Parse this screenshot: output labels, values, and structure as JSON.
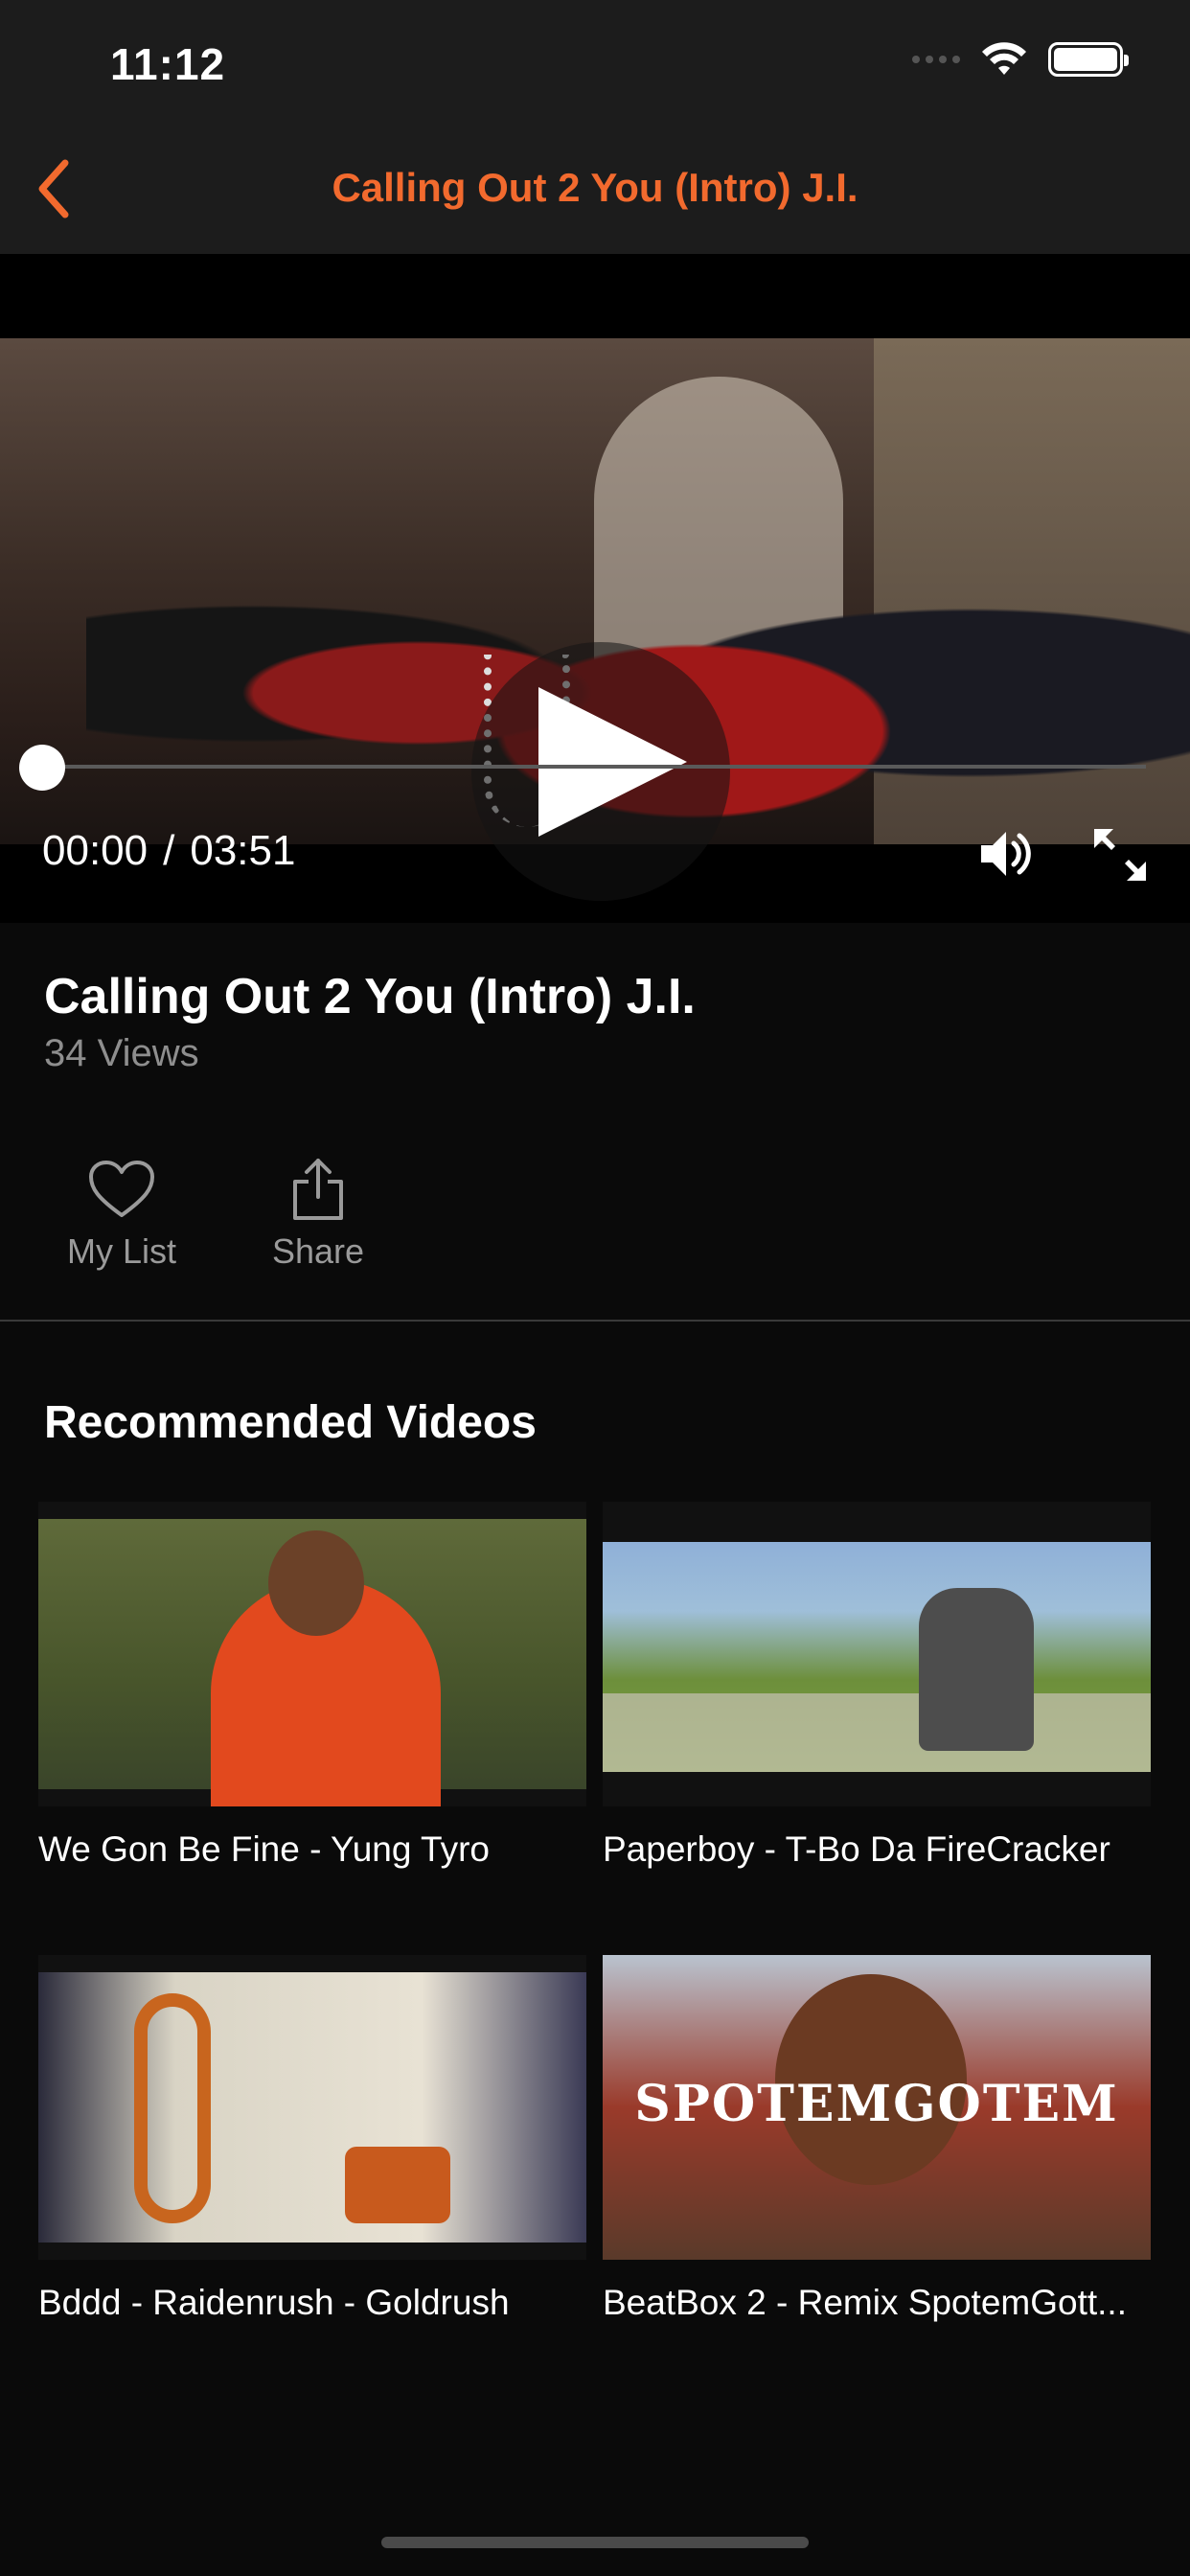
{
  "status_bar": {
    "time": "11:12"
  },
  "nav": {
    "title": "Calling Out 2 You (Intro) J.I."
  },
  "player": {
    "current_time": "00:00",
    "separator": "/",
    "duration": "03:51",
    "progress": 0
  },
  "video": {
    "title": "Calling Out 2 You (Intro) J.I.",
    "views": "34 Views"
  },
  "actions": {
    "my_list": "My List",
    "share": "Share"
  },
  "recommended": {
    "title": "Recommended Videos",
    "items": [
      {
        "caption": "We Gon Be Fine - Yung Tyro"
      },
      {
        "caption": "Paperboy - T-Bo Da FireCracker"
      },
      {
        "caption": "Bddd - Raidenrush - Goldrush"
      },
      {
        "caption": "BeatBox 2 - Remix  SpotemGott...",
        "thumbnail_text": "SPOTEMGOTEM"
      }
    ]
  },
  "colors": {
    "accent": "#f26a2e",
    "background": "#0a0a0a",
    "header": "#1c1c1c"
  }
}
